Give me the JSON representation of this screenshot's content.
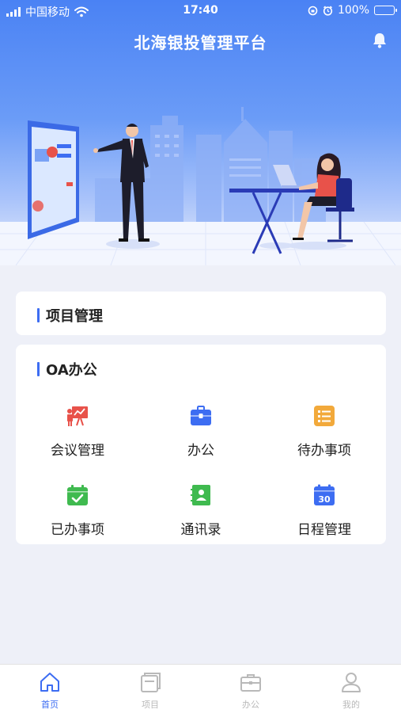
{
  "status_bar": {
    "carrier": "中国移动",
    "time": "17:40",
    "battery": "100%"
  },
  "header": {
    "title": "北海银投管理平台",
    "notification_icon": "bell-icon"
  },
  "sections": {
    "project": {
      "title": "项目管理"
    },
    "oa": {
      "title": "OA办公",
      "items": [
        {
          "label": "会议管理",
          "icon": "meeting-presentation-icon",
          "color": "#e8524a"
        },
        {
          "label": "办公",
          "icon": "briefcase-icon",
          "color": "#3d6df2"
        },
        {
          "label": "待办事项",
          "icon": "todo-list-icon",
          "color": "#f2a93b"
        },
        {
          "label": "已办事项",
          "icon": "calendar-check-icon",
          "color": "#3fba4f"
        },
        {
          "label": "通讯录",
          "icon": "contacts-book-icon",
          "color": "#3fba4f"
        },
        {
          "label": "日程管理",
          "icon": "calendar-30-icon",
          "color": "#3d6df2",
          "day": "30"
        }
      ]
    }
  },
  "tab_bar": {
    "tabs": [
      {
        "label": "首页",
        "icon": "home-icon",
        "active": true
      },
      {
        "label": "项目",
        "icon": "project-stack-icon",
        "active": false
      },
      {
        "label": "办公",
        "icon": "briefcase-icon",
        "active": false
      },
      {
        "label": "我的",
        "icon": "user-icon",
        "active": false
      }
    ]
  },
  "colors": {
    "accent": "#3d6df2",
    "header_gradient_top": "#4a82f4",
    "page_background": "#eef0f8",
    "inactive_tab": "#b9b9b9"
  }
}
